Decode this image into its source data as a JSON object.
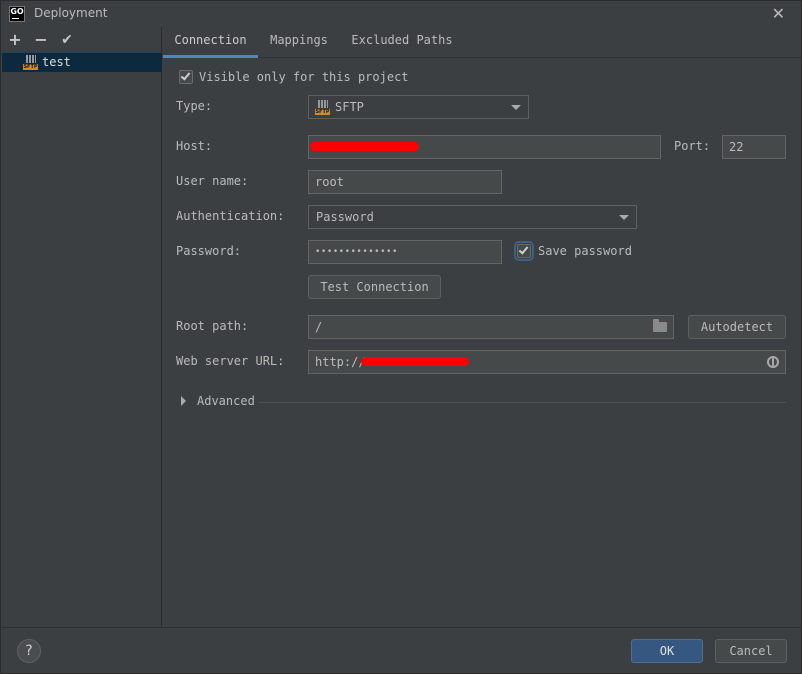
{
  "window": {
    "title": "Deployment",
    "app_icon_text": "GO",
    "close_glyph": "✕"
  },
  "left_toolbar": {
    "add": "+",
    "remove": "−",
    "apply": "✔"
  },
  "servers": [
    {
      "name": "test",
      "icon": "sftp-icon"
    }
  ],
  "sftp_badge": "SFTP",
  "tabs": [
    {
      "label": "Connection",
      "active": true
    },
    {
      "label": "Mappings",
      "active": false
    },
    {
      "label": "Excluded Paths",
      "active": false
    }
  ],
  "form": {
    "visible_only": {
      "label": "Visible only for this project",
      "checked": true
    },
    "type": {
      "label": "Type:",
      "value": "SFTP"
    },
    "host": {
      "label": "Host:",
      "value": ""
    },
    "port": {
      "label": "Port:",
      "value": "22"
    },
    "user_name": {
      "label": "User name:",
      "value": "root"
    },
    "authentication": {
      "label": "Authentication:",
      "value": "Password"
    },
    "password": {
      "label": "Password:",
      "value": "••••••••••••••"
    },
    "save_password": {
      "label": "Save password",
      "checked": true
    },
    "test_connection": "Test Connection",
    "root_path": {
      "label": "Root path:",
      "value": "/"
    },
    "autodetect": "Autodetect",
    "web_server_url": {
      "label": "Web server URL:",
      "value": "http://"
    },
    "advanced": "Advanced"
  },
  "footer": {
    "help": "?",
    "ok": "OK",
    "cancel": "Cancel"
  },
  "colors": {
    "accent": "#4a88c7",
    "selection": "#0d293e",
    "ok_button": "#365880",
    "redaction": "#ff0000"
  }
}
